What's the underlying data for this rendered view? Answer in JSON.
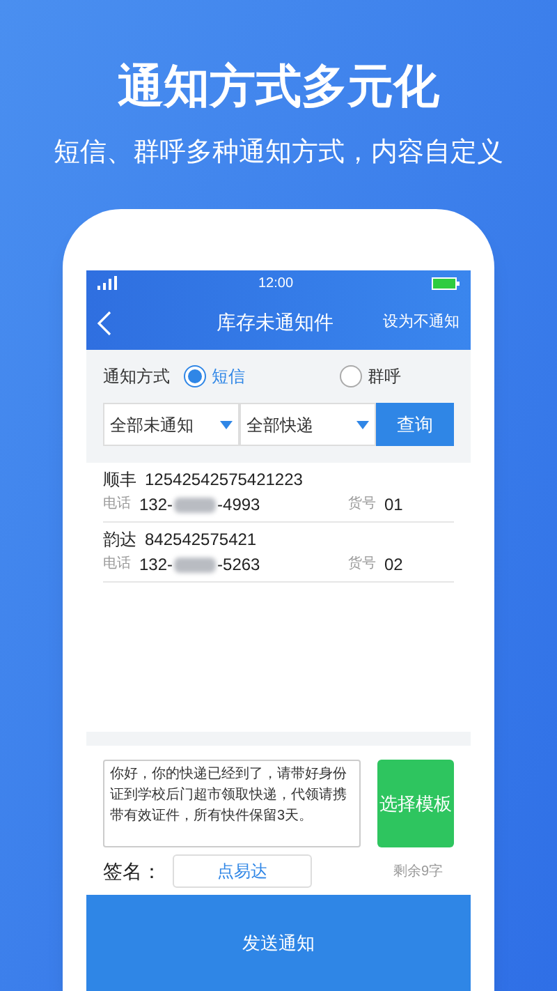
{
  "headline": "通知方式多元化",
  "subheadline": "短信、群呼多种通知方式，内容自定义",
  "status_bar": {
    "time": "12:00"
  },
  "nav": {
    "title": "库存未通知件",
    "action": "设为不通知"
  },
  "notify_method": {
    "label": "通知方式",
    "options": [
      {
        "label": "短信",
        "selected": true
      },
      {
        "label": "群呼",
        "selected": false
      }
    ]
  },
  "filters": [
    {
      "value": "全部未通知"
    },
    {
      "value": "全部快递"
    }
  ],
  "query_button": "查询",
  "parcels": [
    {
      "carrier": "顺丰",
      "tracking": "12542542575421223",
      "phone_label": "电话",
      "phone_prefix": "132-",
      "phone_suffix": "-4993",
      "number_label": "货号",
      "number": "01"
    },
    {
      "carrier": "韵达",
      "tracking": "842542575421",
      "phone_label": "电话",
      "phone_prefix": "132-",
      "phone_suffix": "-5263",
      "number_label": "货号",
      "number": "02"
    }
  ],
  "message": {
    "value": "你好，你的快递已经到了，请带好身份证到学校后门超市领取快递，代领请携带有效证件，所有快件保留3天。"
  },
  "template_button": "选择模板",
  "signature": {
    "label": "签名：",
    "value": "点易达",
    "remaining": "剩余9字"
  },
  "send_button": "发送通知"
}
